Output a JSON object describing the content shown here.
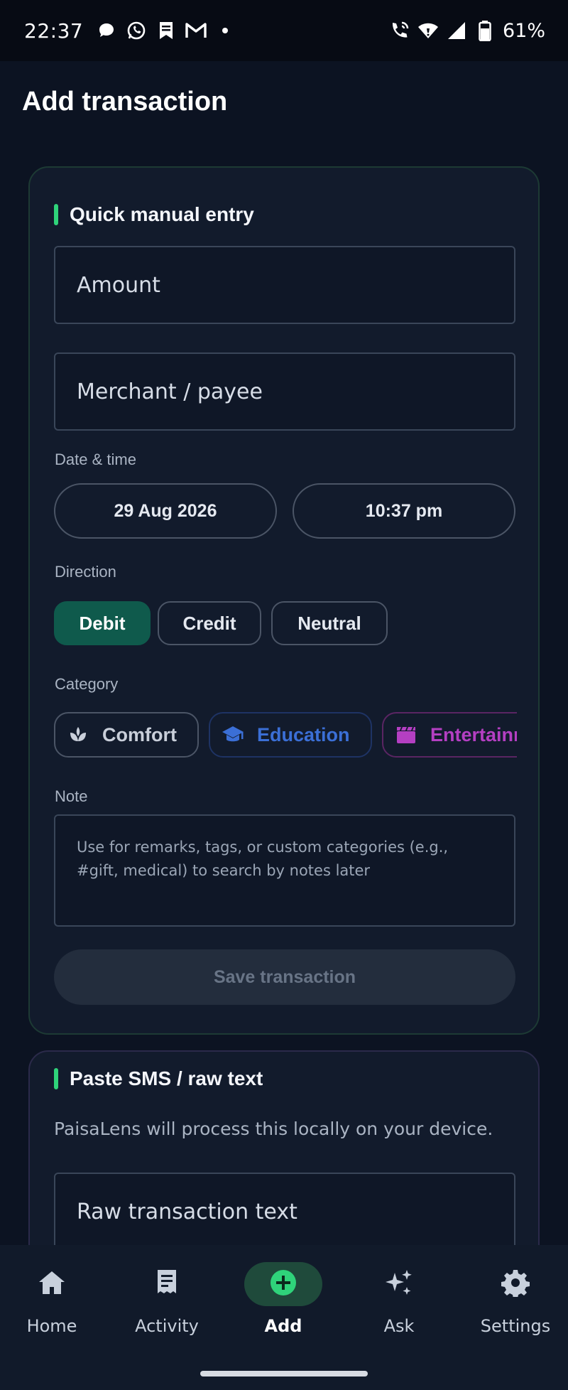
{
  "status_bar": {
    "time": "22:37",
    "battery": "61%",
    "icons": [
      "chat-bubble-icon",
      "whatsapp-icon",
      "bookmark-icon",
      "gmail-icon",
      "dot-icon",
      "wifi-calling-icon",
      "wifi-icon",
      "signal-icon",
      "battery-icon"
    ]
  },
  "page": {
    "title": "Add transaction"
  },
  "manual_entry": {
    "title": "Quick manual entry",
    "amount_placeholder": "Amount",
    "merchant_placeholder": "Merchant / payee",
    "datetime_label": "Date & time",
    "date_value": "29 Aug 2026",
    "time_value": "10:37 pm",
    "direction_label": "Direction",
    "directions": [
      {
        "label": "Debit",
        "selected": true
      },
      {
        "label": "Credit",
        "selected": false
      },
      {
        "label": "Neutral",
        "selected": false
      }
    ],
    "category_label": "Category",
    "categories": [
      {
        "label": "Comfort",
        "icon": "lotus-icon",
        "color": "#c9cfda"
      },
      {
        "label": "Education",
        "icon": "graduation-cap-icon",
        "color": "#3b6fd6"
      },
      {
        "label": "Entertainment",
        "icon": "clapperboard-icon",
        "color": "#b43fc2"
      }
    ],
    "note_label": "Note",
    "note_placeholder": "Use for remarks, tags, or custom categories (e.g., #gift, medical) to search by notes later",
    "save_label": "Save transaction"
  },
  "sms_entry": {
    "title": "Paste SMS / raw text",
    "subtitle": "PaisaLens will process this locally on your device.",
    "raw_placeholder": "Raw transaction text"
  },
  "bottom_nav": {
    "items": [
      {
        "label": "Home",
        "icon": "home-icon",
        "active": false
      },
      {
        "label": "Activity",
        "icon": "receipt-icon",
        "active": false
      },
      {
        "label": "Add",
        "icon": "add-circle-icon",
        "active": true
      },
      {
        "label": "Ask",
        "icon": "sparkle-icon",
        "active": false
      },
      {
        "label": "Settings",
        "icon": "gear-icon",
        "active": false
      }
    ]
  },
  "colors": {
    "accent_green": "#2fd37a",
    "active_chip": "#0f5a4c",
    "background": "#0c1322"
  }
}
